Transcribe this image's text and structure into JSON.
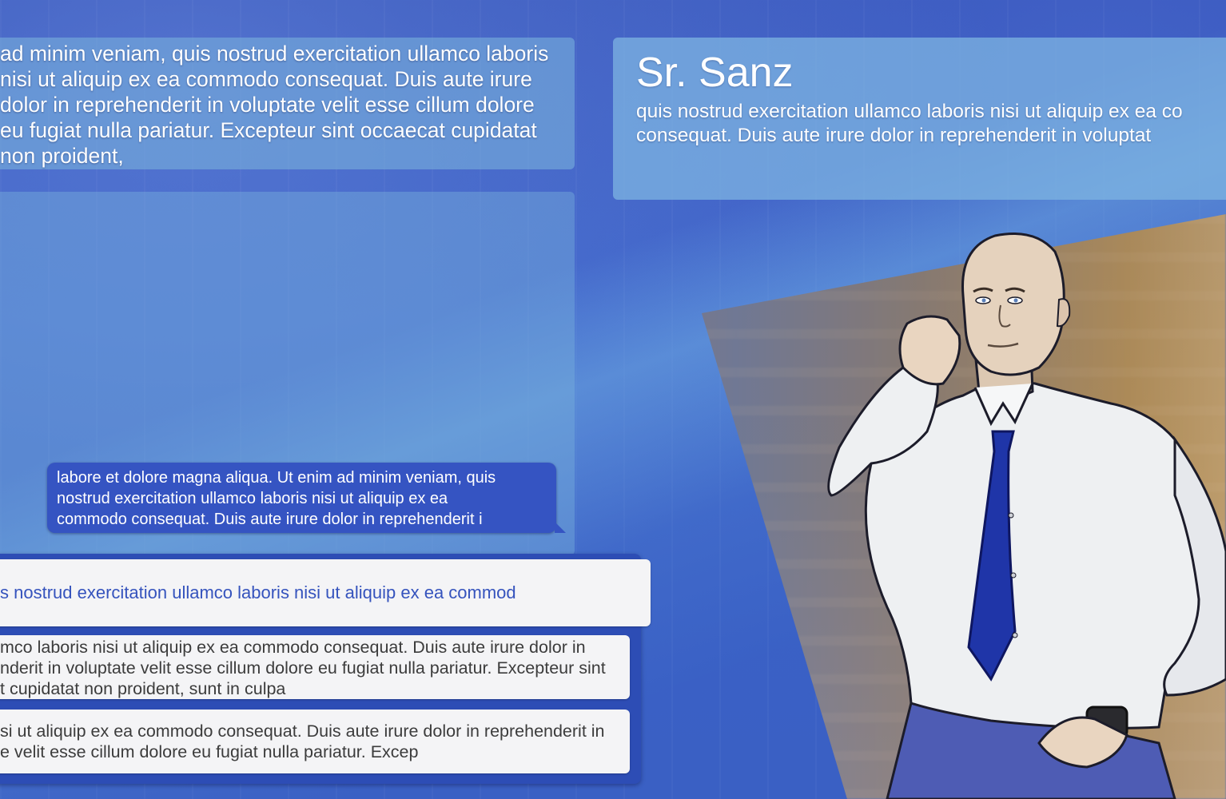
{
  "narration": {
    "text": "ad minim veniam, quis nostrud exercitation ullamco laboris\nnisi ut aliquip ex ea commodo consequat. Duis aute irure\ndolor in reprehenderit in voluptate velit esse cillum dolore\neu fugiat nulla pariatur. Excepteur sint occaecat cupidatat\nnon proident,"
  },
  "chat": {
    "message": "labore et dolore magna aliqua. Ut enim ad minim veniam, quis\nnostrud exercitation ullamco laboris nisi ut aliquip ex ea\ncommodo consequat. Duis aute irure dolor in reprehenderit i"
  },
  "character": {
    "name": "Sr. Sanz",
    "description": " quis nostrud exercitation ullamco laboris nisi ut aliquip ex ea co\nconsequat. Duis aute irure dolor in reprehenderit in voluptat"
  },
  "choices": [
    {
      "label": "s nostrud exercitation ullamco laboris nisi ut aliquip ex ea commod"
    },
    {
      "label": "mco laboris nisi ut aliquip ex ea commodo consequat. Duis aute irure dolor in\nnderit in voluptate velit esse cillum dolore eu fugiat nulla pariatur. Excepteur sint\nt cupidatat non proident, sunt in culpa"
    },
    {
      "label": "si ut aliquip ex ea commodo consequat. Duis aute irure dolor in reprehenderit in\ne velit esse cillum dolore eu fugiat nulla pariatur. Excep"
    }
  ],
  "colors": {
    "background": "#3a62c8",
    "chat_bubble": "#3554c2",
    "choice_frame": "#2d4db5",
    "choice_highlight_text": "#3553bd",
    "tie": "#1f35a8"
  }
}
